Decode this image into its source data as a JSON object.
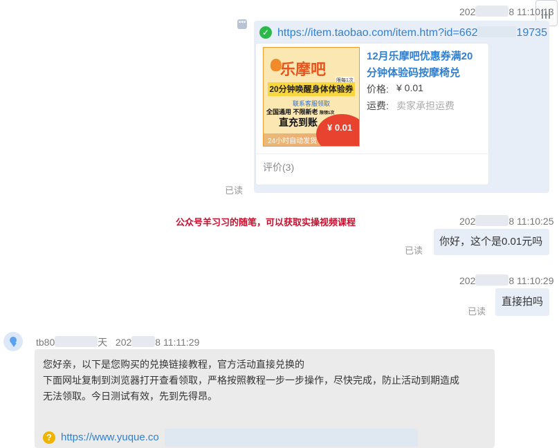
{
  "msg1": {
    "timestamp_prefix": "202",
    "timestamp_suffix": "8 11:10:13",
    "url_prefix": "https://item.taobao.com/item.htm?id=662",
    "url_suffix": "19735",
    "card": {
      "title": "12月乐摩吧优惠券满20分钟体验码按摩椅兑",
      "price_label": "价格:",
      "price_value": "¥ 0.01",
      "shipping_label": "运费:",
      "shipping_value": "卖家承担运费",
      "review": "评价(3)",
      "image": {
        "logo": "乐摩吧",
        "tag": "限每1次",
        "band": "20分钟唤醒身体体验券",
        "contact": "联系客服领取",
        "rules": "全国通用 不限新老",
        "rules_small": "限领1次",
        "direct": "直充到账",
        "price": "¥ 0.01",
        "footer": "24小时自动发货"
      }
    },
    "read": "已读"
  },
  "watermark": "公众号羊习习的随笔，可以获取实操视频课程",
  "msg2": {
    "timestamp_prefix": "202",
    "timestamp_suffix": "8 11:10:25",
    "text": "你好，这个是0.01元吗",
    "read": "已读"
  },
  "msg3": {
    "timestamp_prefix": "202",
    "timestamp_suffix": "8 11:10:29",
    "text": "直接拍吗",
    "read": "已读"
  },
  "reply": {
    "sender_prefix": "tb80",
    "sender_suffix": "天",
    "timestamp_prefix": "202",
    "timestamp_suffix": "8 11:11:29",
    "line1": "您好亲，以下是您购买的兑换链接教程，官方活动直接兑换的",
    "line2": "下面网址复制到浏览器打开查看领取，严格按照教程一步一步操作，尽快完成，防止活动到期造成",
    "line3": "无法领取。今日测试有效，先到先得昂。",
    "link_prefix": "https://www.yuque.co"
  },
  "icons": {
    "corner": "window-corner-icon",
    "more": "more-dots-icon",
    "check": "check-circle-icon",
    "question": "question-circle-icon",
    "avatar": "user-avatar-icon"
  },
  "colors": {
    "link": "#2f7fd2",
    "bubble": "#e8eef7",
    "reply_bubble": "#ebebeb",
    "watermark": "#c8102e",
    "check": "#2db84b"
  }
}
